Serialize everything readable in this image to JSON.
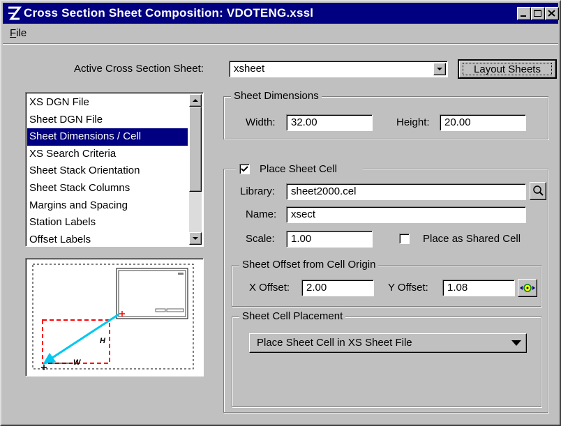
{
  "window": {
    "title": "Cross Section Sheet Composition: VDOTENG.xssl"
  },
  "menu": {
    "file_u": "F",
    "file_rest": "ile"
  },
  "active_sheet": {
    "label": "Active Cross Section Sheet:",
    "value": "xsheet"
  },
  "layout_button": "Layout Sheets",
  "list": {
    "items": [
      "XS DGN File",
      "Sheet DGN File",
      "Sheet Dimensions / Cell",
      "XS Search Criteria",
      "Sheet Stack Orientation",
      "Sheet Stack Columns",
      "Margins and Spacing",
      "Station Labels",
      "Offset Labels"
    ],
    "selected_index": 2
  },
  "preview": {
    "h_label": "H",
    "w_label": "W"
  },
  "sheet_dimensions": {
    "title": "Sheet Dimensions",
    "width_label": "Width:",
    "width_value": "32.00",
    "height_label": "Height:",
    "height_value": "20.00"
  },
  "place_cell": {
    "title": "Place Sheet Cell",
    "checked": true,
    "library_label": "Library:",
    "library_value": "sheet2000.cel",
    "name_label": "Name:",
    "name_value": "xsect",
    "scale_label": "Scale:",
    "scale_value": "1.00",
    "shared_label": "Place as Shared Cell",
    "shared_checked": false
  },
  "offset": {
    "title": "Sheet Offset from Cell Origin",
    "x_label": "X Offset:",
    "x_value": "2.00",
    "y_label": "Y Offset:",
    "y_value": "1.08"
  },
  "placement": {
    "title": "Sheet Cell Placement",
    "value": "Place Sheet Cell in XS Sheet File"
  },
  "colors": {
    "titlebar": "#000080",
    "selection": "#000080",
    "preview_sheet": "#ff0000",
    "preview_arrow": "#00c8f0"
  }
}
